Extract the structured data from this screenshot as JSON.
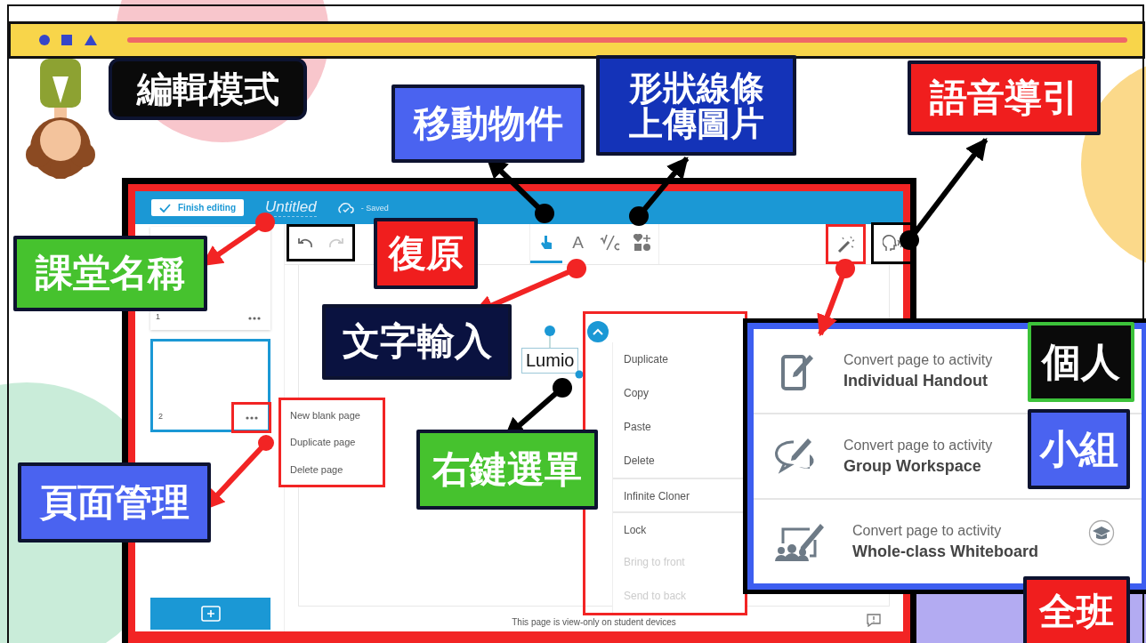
{
  "annotations": [
    {
      "text": "編輯模式",
      "color": "#0a0a0a"
    },
    {
      "text": "形狀線條",
      "color": "#1433b8"
    },
    {
      "text": "上傳圖片",
      "color": "#1433b8"
    },
    {
      "text": "語音導引",
      "color": "#f01e1e"
    },
    {
      "text": "移動物件",
      "color": "#4a63f0"
    },
    {
      "text": "課堂名稱",
      "color": "#46c22e"
    },
    {
      "text": "復原",
      "color": "#f01e1e"
    },
    {
      "text": "文字輸入",
      "color": "#0a1240"
    },
    {
      "text": "個人",
      "color": "#0a0a0a"
    },
    {
      "text": "小組",
      "color": "#4a63f0"
    },
    {
      "text": "右鍵選單",
      "color": "#46c22e"
    },
    {
      "text": "頁面管理",
      "color": "#4a63f0"
    },
    {
      "text": "全班",
      "color": "#f01e1e"
    }
  ],
  "app": {
    "header": {
      "finish_button": "Finish editing",
      "title": "Untitled",
      "save_status": "- Saved"
    },
    "undo": {
      "disabled": false
    },
    "redo": {
      "disabled": true
    },
    "tools": [
      {
        "kind": "hand",
        "selected": true
      },
      {
        "kind": "text",
        "label": "A",
        "selected": false
      },
      {
        "kind": "math",
        "selected": false
      },
      {
        "kind": "shapes",
        "selected": false
      }
    ],
    "pages": [
      {
        "number": "1",
        "selected": false
      },
      {
        "number": "2",
        "selected": true
      }
    ],
    "page_menu": [
      "New blank page",
      "Duplicate page",
      "Delete page"
    ],
    "canvas_text": "Lumio",
    "context_menu": [
      {
        "label": "Duplicate",
        "disabled": false,
        "divider_before": false
      },
      {
        "label": "Copy",
        "disabled": false,
        "divider_before": false
      },
      {
        "label": "Paste",
        "disabled": false,
        "divider_before": false
      },
      {
        "label": "Delete",
        "disabled": false,
        "divider_before": false
      },
      {
        "label": "Infinite Cloner",
        "disabled": false,
        "divider_before": true
      },
      {
        "label": "Lock",
        "disabled": false,
        "divider_before": true
      },
      {
        "label": "Bring to front",
        "disabled": true,
        "divider_before": false
      },
      {
        "label": "Send to back",
        "disabled": true,
        "divider_before": false
      }
    ],
    "footer_note": "This page is view-only on student devices",
    "activities": [
      {
        "kind": "handout",
        "caption": "Convert page to activity",
        "title": "Individual Handout"
      },
      {
        "kind": "group",
        "caption": "Convert page to activity",
        "title": "Group Workspace"
      },
      {
        "kind": "whiteboard",
        "caption": "Convert page to activity",
        "title": "Whole-class Whiteboard"
      }
    ]
  }
}
